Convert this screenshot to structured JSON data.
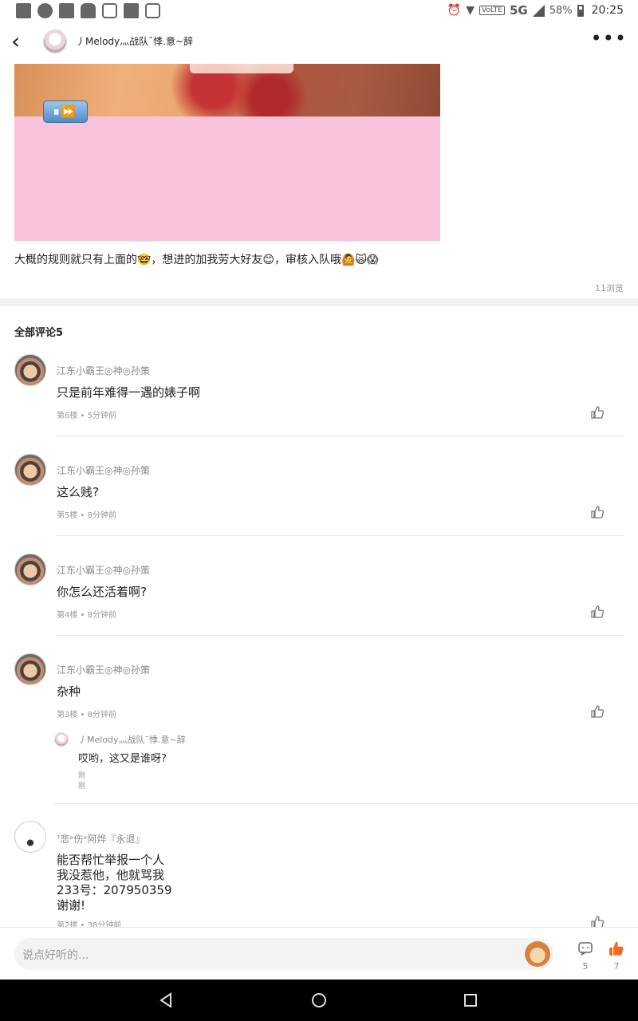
{
  "status_bar": {
    "volte": "VoLTE",
    "network": "5G",
    "battery": "58%",
    "time": "20:25"
  },
  "header": {
    "title": "丿Melody灬战队ˉ悸.意~辞"
  },
  "post": {
    "text": "大概的规则就只有上面的🤓，想进的加我劳大好友😊，审核入队哦🙆🙀😱",
    "views": "11浏览",
    "video_controls": "⏸⏩"
  },
  "comments_title": "全部评论5",
  "comments": [
    {
      "user": "江东小霸王◎神◎孙策",
      "text": "只是前年难得一遇的婊子啊",
      "meta": "第6楼 • 5分钟前"
    },
    {
      "user": "江东小霸王◎神◎孙策",
      "text": "这么贱?",
      "meta": "第5楼 • 8分钟前"
    },
    {
      "user": "江东小霸王◎神◎孙策",
      "text": "你怎么还活着啊?",
      "meta": "第4楼 • 8分钟前"
    },
    {
      "user": "江东小霸王◎神◎孙策",
      "text": "杂种",
      "meta": "第3楼 • 8分钟前",
      "reply": {
        "user": "丿Melody灬战队ˉ悸.意~辞",
        "text": "哎哟，这又是谁呀?",
        "meta": "刚刚"
      }
    },
    {
      "user": "ꜛ悲ᵉ伤ᵉ阿烨『永退』",
      "text": "能否帮忙举报一个人\n我没惹他，他就骂我\n233号：207950359\n谢谢!",
      "meta": "第2楼 • 38分钟前"
    }
  ],
  "input": {
    "placeholder": "说点好听的..."
  },
  "actions": {
    "comment_count": "5",
    "like_count": "7"
  },
  "colors": {
    "accent": "#f36a1e",
    "image_pink": "#f9c3dc"
  }
}
